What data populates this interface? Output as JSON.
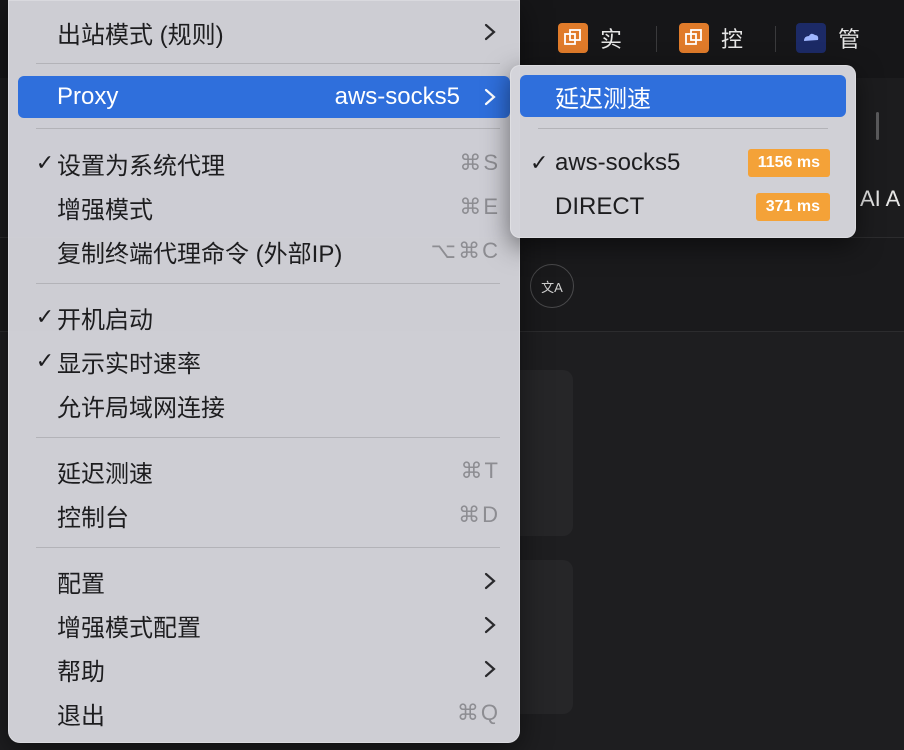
{
  "background": {
    "tabs": [
      {
        "label": "实",
        "icon": "proxy-app-icon"
      },
      {
        "label": "控",
        "icon": "proxy-app-icon"
      },
      {
        "label": "管",
        "icon": "cloud-logo-icon"
      }
    ],
    "side_label": "AI A",
    "translate_icon": "文A"
  },
  "menu": {
    "outbound_mode": {
      "label": "出站模式 (规则)"
    },
    "proxy": {
      "label": "Proxy",
      "value": "aws-socks5"
    },
    "set_system_proxy": {
      "label": "设置为系统代理",
      "shortcut": "⌘S",
      "checked": true
    },
    "enhanced_mode": {
      "label": "增强模式",
      "shortcut": "⌘E"
    },
    "copy_terminal": {
      "label": "复制终端代理命令 (外部IP)",
      "shortcut": "⌥⌘C"
    },
    "launch_at_login": {
      "label": "开机启动",
      "checked": true
    },
    "show_speed": {
      "label": "显示实时速率",
      "checked": true
    },
    "allow_lan": {
      "label": "允许局域网连接"
    },
    "latency_test": {
      "label": "延迟测速",
      "shortcut": "⌘T"
    },
    "dashboard": {
      "label": "控制台",
      "shortcut": "⌘D"
    },
    "config": {
      "label": "配置"
    },
    "enhanced_config": {
      "label": "增强模式配置"
    },
    "help": {
      "label": "帮助"
    },
    "quit": {
      "label": "退出",
      "shortcut": "⌘Q"
    }
  },
  "submenu": {
    "latency_test": {
      "label": "延迟测速"
    },
    "items": [
      {
        "label": "aws-socks5",
        "latency": "1156 ms",
        "checked": true
      },
      {
        "label": "DIRECT",
        "latency": "371 ms",
        "checked": false
      }
    ]
  },
  "colors": {
    "accent": "#2f6fdc",
    "latency_badge": "#f4a238"
  }
}
